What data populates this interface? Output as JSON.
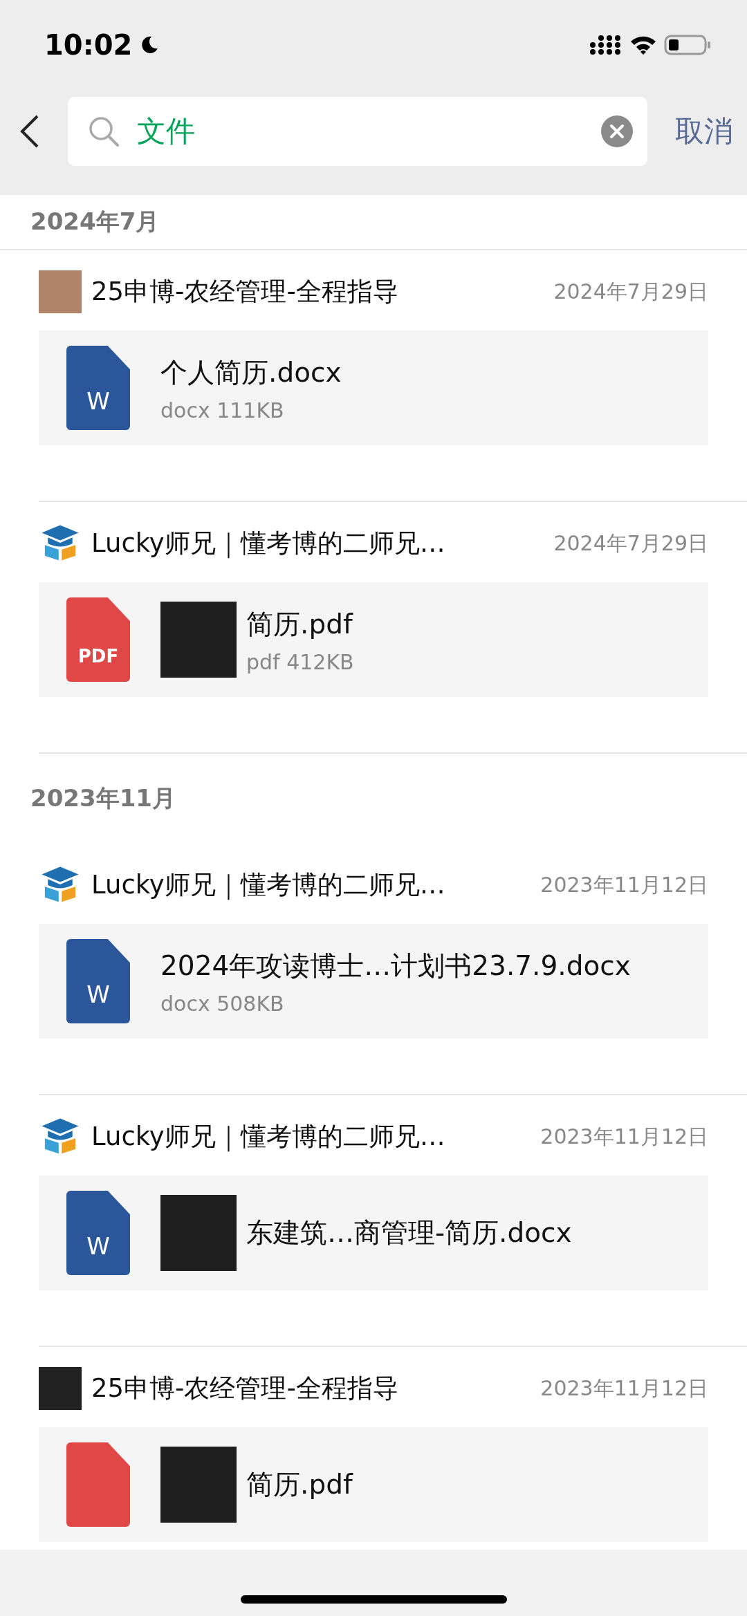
{
  "status_bar": {
    "time": "10:02"
  },
  "search": {
    "value": "文件",
    "cancel": "取消"
  },
  "sections": [
    {
      "title": "2024年7月",
      "items": [
        {
          "avatar": {
            "kind": "photo"
          },
          "sender": "25申博-农经管理-全程指导",
          "date": "2024年7月29日",
          "file": {
            "kind": "docx",
            "icon_label": "W",
            "name": "个人简历.docx",
            "size": "docx 111KB"
          },
          "redacted": false
        },
        {
          "avatar": {
            "kind": "logo"
          },
          "sender": "Lucky师兄｜懂考博的二师兄…",
          "date": "2024年7月29日",
          "file": {
            "kind": "pdf",
            "icon_label": "PDF",
            "name": "简历.pdf",
            "size": "pdf 412KB"
          },
          "redacted": true
        }
      ]
    },
    {
      "title": "2023年11月",
      "items": [
        {
          "avatar": {
            "kind": "logo"
          },
          "sender": "Lucky师兄｜懂考博的二师兄…",
          "date": "2023年11月12日",
          "file": {
            "kind": "docx",
            "icon_label": "W",
            "name": "2024年攻读博士…计划书23.7.9.docx",
            "size": "docx 508KB"
          },
          "redacted": false
        },
        {
          "avatar": {
            "kind": "logo"
          },
          "sender": "Lucky师兄｜懂考博的二师兄…",
          "date": "2023年11月12日",
          "file": {
            "kind": "docx",
            "icon_label": "W",
            "name": "东建筑…商管理-简历.docx"
          },
          "redacted": true
        },
        {
          "avatar": {
            "kind": "hidden"
          },
          "sender": "25申博-农经管理-全程指导",
          "date": "2023年11月12日",
          "file": {
            "kind": "pdf",
            "name": "简历.pdf"
          },
          "redacted": true
        }
      ]
    }
  ]
}
